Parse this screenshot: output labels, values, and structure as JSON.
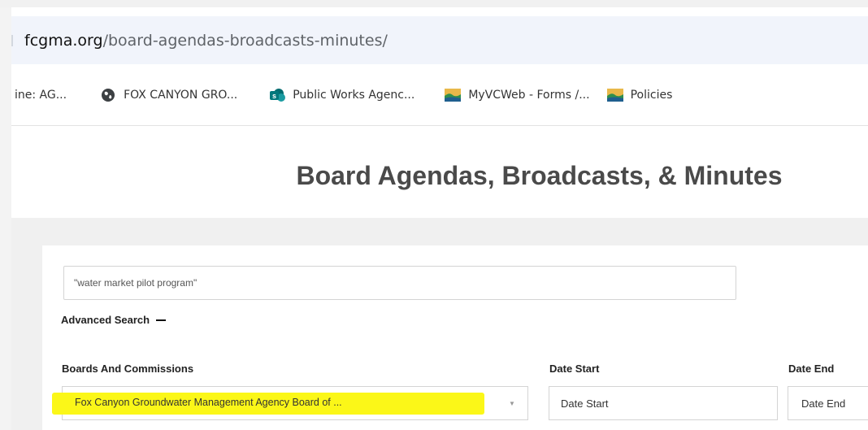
{
  "browser": {
    "url_host": "fcgma.org",
    "url_path": "/board-agendas-broadcasts-minutes/",
    "bookmarks": [
      {
        "label": "ine: AG...",
        "icon": "none"
      },
      {
        "label": "FOX CANYON GRO...",
        "icon": "globe-icon"
      },
      {
        "label": "Public Works Agenc...",
        "icon": "sharepoint-icon"
      },
      {
        "label": "MyVCWeb - Forms /...",
        "icon": "landscape-icon"
      },
      {
        "label": "Policies",
        "icon": "landscape-icon"
      }
    ]
  },
  "page": {
    "title": "Board Agendas, Broadcasts, & Minutes"
  },
  "search": {
    "value": "\"water market pilot program\"",
    "advanced_label": "Advanced Search"
  },
  "filters": {
    "boards_label": "Boards And Commissions",
    "boards_value": "Fox Canyon Groundwater Management Agency Board of ...",
    "date_start_label": "Date Start",
    "date_start_placeholder": "Date Start",
    "date_end_label": "Date End",
    "date_end_placeholder": "Date End"
  },
  "colors": {
    "highlight": "#fbf718",
    "title": "#4a4a4a"
  }
}
